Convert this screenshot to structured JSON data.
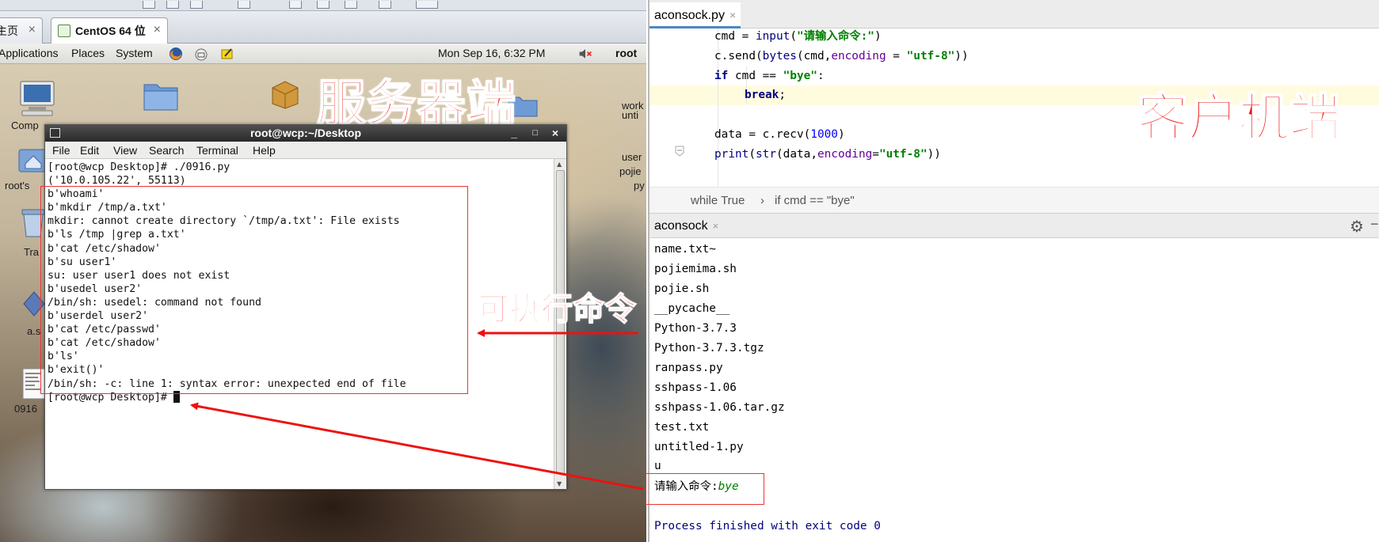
{
  "vm": {
    "tabs": [
      {
        "label": "主页",
        "active": false
      },
      {
        "label": "CentOS 64 位",
        "active": true
      }
    ],
    "panel": {
      "applications": "Applications",
      "places": "Places",
      "system": "System",
      "clock": "Mon Sep 16,  6:32 PM",
      "user": "root"
    },
    "desktop_icons": [
      {
        "label": "Comp"
      },
      {
        "label": "root's"
      },
      {
        "label": "Tra"
      },
      {
        "label": "a.s"
      },
      {
        "label": "0916"
      },
      {
        "label": "work"
      },
      {
        "label": "unti"
      },
      {
        "label": "user"
      },
      {
        "label": "pojie"
      },
      {
        "label": "py"
      }
    ],
    "overlay_label": "服务器端",
    "terminal": {
      "title": "root@wcp:~/Desktop",
      "menu": [
        "File",
        "Edit",
        "View",
        "Search",
        "Terminal",
        "Help"
      ],
      "lines": [
        "[root@wcp Desktop]# ./0916.py",
        "('10.0.105.22', 55113)",
        "b'whoami'",
        "b'mkdir /tmp/a.txt'",
        "mkdir: cannot create directory `/tmp/a.txt': File exists",
        "b'ls /tmp |grep a.txt'",
        "b'cat /etc/shadow'",
        "b'su user1'",
        "su: user user1 does not exist",
        "b'usedel user2'",
        "/bin/sh: usedel: command not found",
        "b'userdel user2'",
        "b'cat /etc/passwd'",
        "b'cat /etc/shadow'",
        "b'ls'",
        "b'exit()'",
        "/bin/sh: -c: line 1: syntax error: unexpected end of file"
      ],
      "prompt": "[root@wcp Desktop]# "
    }
  },
  "annotation_exec": "可执行命令",
  "ide": {
    "editor_tab": "aconsock.py",
    "overlay_label": "客户机端",
    "code": {
      "l1_pre": "cmd = ",
      "l1_fn": "input",
      "l1_open": "(",
      "l1_str": "\"请输入命令:\"",
      "l1_close": ")",
      "l2_pre": "c.send(",
      "l2_fn": "bytes",
      "l2_mid": "(cmd,",
      "l2_param": "encoding",
      "l2_eq": " = ",
      "l2_str": "\"utf-8\"",
      "l2_close": "))",
      "l3_kw": "if",
      "l3_mid": " cmd == ",
      "l3_str": "\"bye\"",
      "l3_colon": ":",
      "l4_kw": "break",
      "l4_semi": ";",
      "l6_pre": "data = c.recv(",
      "l6_num": "1000",
      "l6_close": ")",
      "l7_fn": "print",
      "l7_open": "(",
      "l7_fn2": "str",
      "l7_mid": "(data,",
      "l7_param": "encoding",
      "l7_eq": "=",
      "l7_str": "\"utf-8\"",
      "l7_close": "))"
    },
    "breadcrumb": [
      "while True",
      "›",
      "if cmd == \"bye\""
    ],
    "run_tab": "aconsock",
    "console": {
      "lines": [
        "name.txt~",
        "pojiemima.sh",
        "pojie.sh",
        "__pycache__",
        "Python-3.7.3",
        "Python-3.7.3.tgz",
        "ranpass.py",
        "sshpass-1.06",
        "sshpass-1.06.tar.gz",
        "test.txt",
        "untitled-1.py",
        "u"
      ],
      "input_prompt": "请输入命令:",
      "input_value": "bye",
      "exit_message": "Process finished with exit code 0"
    }
  },
  "colors": {
    "annotation_red": "#e11111",
    "string_green": "#008000",
    "keyword_navy": "#00007f"
  }
}
